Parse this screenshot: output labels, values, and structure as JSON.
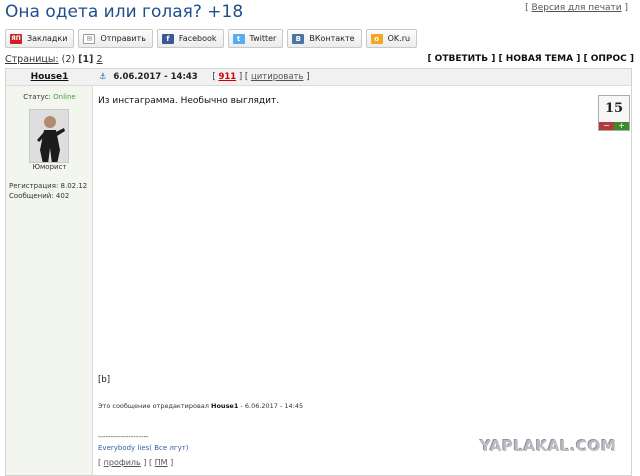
{
  "page": {
    "title": "Она одета или голая? +18",
    "print_version": "Версия для печати"
  },
  "social": [
    {
      "label": "Закладки",
      "icon": "bookmarks-icon",
      "color": "#cc2222",
      "glyph": "ЯП"
    },
    {
      "label": "Отправить",
      "icon": "mail-icon",
      "color": "#888888",
      "glyph": "✉"
    },
    {
      "label": "Facebook",
      "icon": "facebook-icon",
      "color": "#3b5998",
      "glyph": "f"
    },
    {
      "label": "Twitter",
      "icon": "twitter-icon",
      "color": "#55acee",
      "glyph": "t"
    },
    {
      "label": "ВКонтакте",
      "icon": "vk-icon",
      "color": "#4c75a3",
      "glyph": "В"
    },
    {
      "label": "OK.ru",
      "icon": "ok-icon",
      "color": "#f5a623",
      "glyph": "o"
    }
  ],
  "pager": {
    "label": "Страницы:",
    "total": "(2)",
    "current": "[1]",
    "next": "2"
  },
  "actions": {
    "reply": "[ ОТВЕТИТЬ ]",
    "new_topic": "[ НОВАЯ ТЕМА ]",
    "poll": "[ ОПРОС ]"
  },
  "post": {
    "author": "House1",
    "status_label": "Статус:",
    "status_value": "Online",
    "rank": "Юморист",
    "registration": "Регистрация: 8.02.12",
    "messages": "Сообщений: 402",
    "date": "6.06.2017 - 14:43",
    "number": "911",
    "quote": "цитировать",
    "text": "Из инстаграмма. Необычно выглядит.",
    "rating": "15",
    "btag": "[b]",
    "edited_prefix": "Это сообщение отредактировал",
    "edited_user": "House1",
    "edited_suffix": "- 6.06.2017 - 14:45",
    "separator": "--------------------",
    "signature": "Everybody lies( Все лгут)",
    "profile": "профиль",
    "pm": "ПМ"
  },
  "watermark": "YAPLAKAL.COM"
}
